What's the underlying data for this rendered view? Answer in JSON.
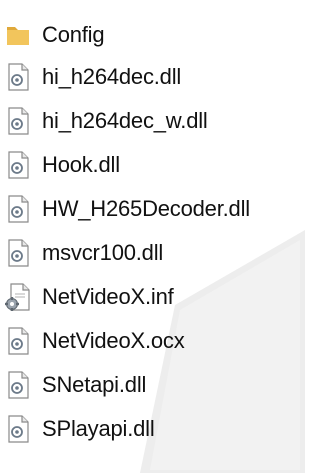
{
  "files": [
    {
      "name": "Config",
      "icon": "folder-icon"
    },
    {
      "name": "hi_h264dec.dll",
      "icon": "dll-file-icon"
    },
    {
      "name": "hi_h264dec_w.dll",
      "icon": "dll-file-icon"
    },
    {
      "name": "Hook.dll",
      "icon": "dll-file-icon"
    },
    {
      "name": "HW_H265Decoder.dll",
      "icon": "dll-file-icon"
    },
    {
      "name": "msvcr100.dll",
      "icon": "dll-file-icon"
    },
    {
      "name": "NetVideoX.inf",
      "icon": "inf-file-icon"
    },
    {
      "name": "NetVideoX.ocx",
      "icon": "dll-file-icon"
    },
    {
      "name": "SNetapi.dll",
      "icon": "dll-file-icon"
    },
    {
      "name": "SPlayapi.dll",
      "icon": "dll-file-icon"
    }
  ],
  "colors": {
    "folder": "#F2C55C",
    "folder_tab": "#E0A93A",
    "text": "#111111",
    "watermark": "#E6E6E6"
  }
}
